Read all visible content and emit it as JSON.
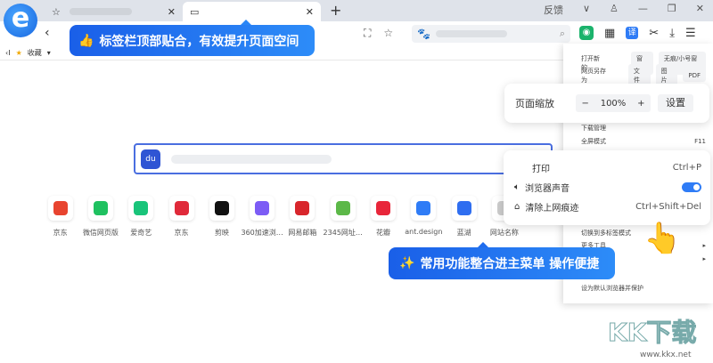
{
  "tabs": [
    {
      "icon": "star-icon"
    },
    {
      "icon": "page-icon"
    }
  ],
  "window": {
    "feedback": "反馈"
  },
  "bookmarks": {
    "collect": "收藏"
  },
  "tips": {
    "top": "标签栏顶部贴合，有效提升页面空间",
    "bottom": "常用功能整合进主菜单 操作便捷"
  },
  "search_logo": "du",
  "sites": [
    {
      "name": "京东",
      "color": "#e8442f"
    },
    {
      "name": "微信网页版",
      "color": "#1fc160"
    },
    {
      "name": "爱奇艺",
      "color": "#19c47a"
    },
    {
      "name": "京东",
      "color": "#e02a3a"
    },
    {
      "name": "剪映",
      "color": "#111111"
    },
    {
      "name": "360加速浏…",
      "color": "#7c5cf5"
    },
    {
      "name": "网易邮箱",
      "color": "#d8262c"
    },
    {
      "name": "2345网址…",
      "color": "#5cb848"
    },
    {
      "name": "花瓣",
      "color": "#e8263a"
    },
    {
      "name": "ant.design",
      "color": "#2f7cf6"
    },
    {
      "name": "蓝湖",
      "color": "#2f6ef0"
    },
    {
      "name": "网站名称",
      "color": "#cccccc"
    }
  ],
  "menu": {
    "open_new": "打开新的",
    "window": "窗口",
    "incognito": "无痕/小号窗口",
    "save_as": "网页另存为",
    "file": "文件",
    "image": "图片",
    "pdf": "PDF",
    "download": "下载管理",
    "fullscreen": "全屏模式",
    "fullscreen_key": "F11",
    "multi_tab": "切换到多标签模式",
    "more_tools": "更多工具",
    "set_default": "设为默认浏览器并保护"
  },
  "zoom_panel": {
    "label": "页面缩放",
    "minus": "−",
    "value": "100%",
    "plus": "+",
    "settings": "设置"
  },
  "popup": {
    "print": "打印",
    "print_key": "Ctrl+P",
    "sound": "浏览器声音",
    "sound_on": true,
    "clear": "清除上网痕迹",
    "clear_key": "Ctrl+Shift+Del"
  },
  "watermark": {
    "logo": "KK下载",
    "url": "www.kkx.net"
  }
}
